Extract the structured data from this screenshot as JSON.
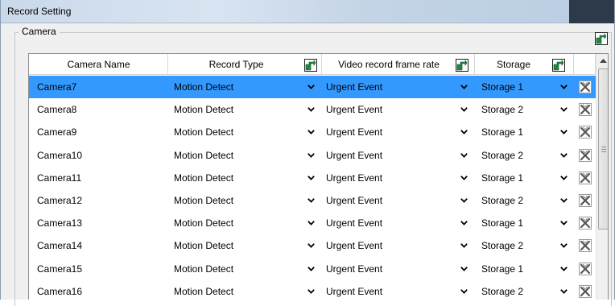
{
  "window": {
    "title": "Record Setting"
  },
  "group": {
    "label": "Camera",
    "edit_icon": "edit-hand-icon"
  },
  "table": {
    "columns": [
      {
        "label": "Camera Name",
        "has_edit": false
      },
      {
        "label": "Record Type",
        "has_edit": true
      },
      {
        "label": "Video record frame rate",
        "has_edit": true
      },
      {
        "label": "Storage",
        "has_edit": true
      },
      {
        "label": "",
        "has_edit": false
      }
    ],
    "rows": [
      {
        "name": "Camera7",
        "record_type": "Motion Detect",
        "frame_rate": "Urgent Event",
        "storage": "Storage 1",
        "selected": true
      },
      {
        "name": "Camera8",
        "record_type": "Motion Detect",
        "frame_rate": "Urgent Event",
        "storage": "Storage 2",
        "selected": false
      },
      {
        "name": "Camera9",
        "record_type": "Motion Detect",
        "frame_rate": "Urgent Event",
        "storage": "Storage 1",
        "selected": false
      },
      {
        "name": "Camera10",
        "record_type": "Motion Detect",
        "frame_rate": "Urgent Event",
        "storage": "Storage 2",
        "selected": false
      },
      {
        "name": "Camera11",
        "record_type": "Motion Detect",
        "frame_rate": "Urgent Event",
        "storage": "Storage 1",
        "selected": false
      },
      {
        "name": "Camera12",
        "record_type": "Motion Detect",
        "frame_rate": "Urgent Event",
        "storage": "Storage 2",
        "selected": false
      },
      {
        "name": "Camera13",
        "record_type": "Motion Detect",
        "frame_rate": "Urgent Event",
        "storage": "Storage 1",
        "selected": false
      },
      {
        "name": "Camera14",
        "record_type": "Motion Detect",
        "frame_rate": "Urgent Event",
        "storage": "Storage 2",
        "selected": false
      },
      {
        "name": "Camera15",
        "record_type": "Motion Detect",
        "frame_rate": "Urgent Event",
        "storage": "Storage 1",
        "selected": false
      },
      {
        "name": "Camera16",
        "record_type": "Motion Detect",
        "frame_rate": "Urgent Event",
        "storage": "Storage 2",
        "selected": false
      }
    ]
  },
  "colors": {
    "selection": "#3399ff",
    "edit_icon": "#1e8a3c",
    "delete_icon": "#555555"
  }
}
